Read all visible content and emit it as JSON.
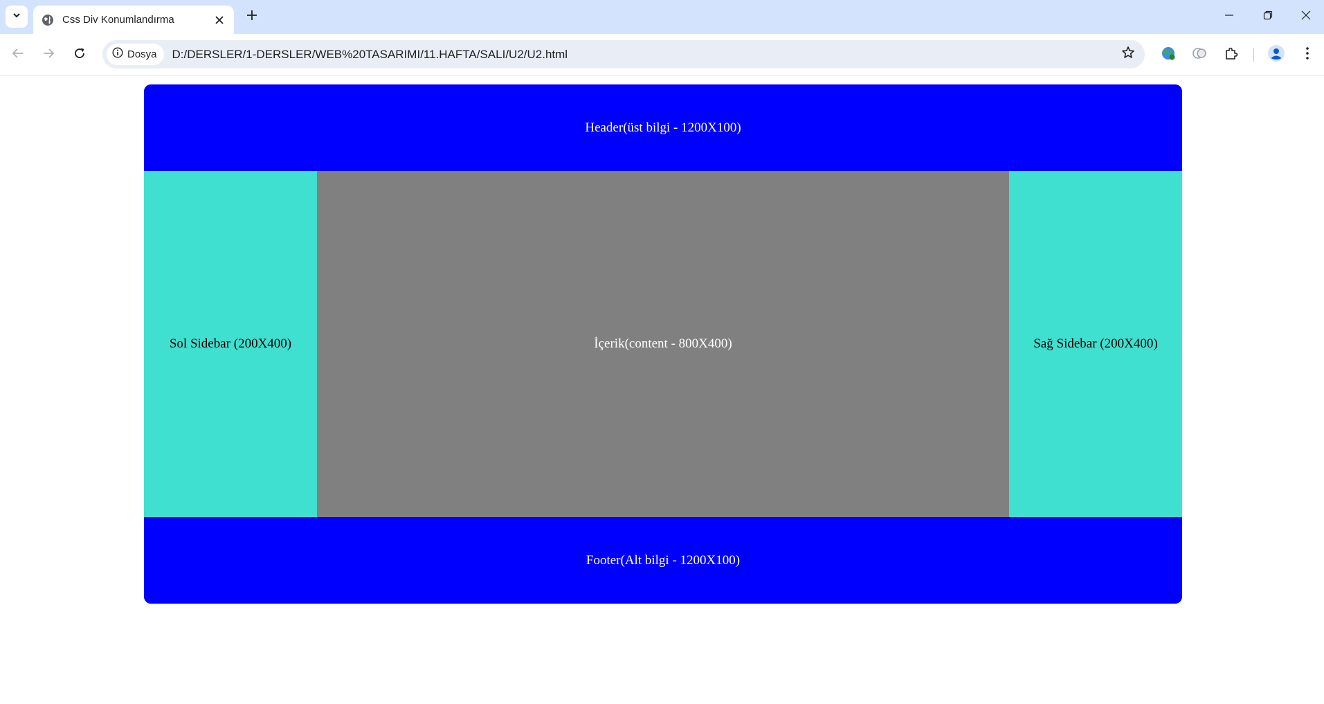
{
  "browser": {
    "tab": {
      "title": "Css Div Konumlandırma"
    },
    "omnibox": {
      "site_chip": "Dosya",
      "url": "D:/DERSLER/1-DERSLER/WEB%20TASARIMI/11.HAFTA/SALI/U2/U2.html"
    },
    "colors": {
      "tabstrip": "#d3e3fd",
      "omnibox": "#e9eef6"
    }
  },
  "page": {
    "header": {
      "text": "Header(üst bilgi - 1200X100)",
      "bg": "#0000ff"
    },
    "left_sidebar": {
      "text": "Sol Sidebar (200X400)",
      "bg": "#40e0d0"
    },
    "content": {
      "text": "İçerik(content - 800X400)",
      "bg": "#808080"
    },
    "right_sidebar": {
      "text": "Sağ Sidebar (200X400)",
      "bg": "#40e0d0"
    },
    "footer": {
      "text": "Footer(Alt bilgi - 1200X100)",
      "bg": "#0000ff"
    }
  }
}
